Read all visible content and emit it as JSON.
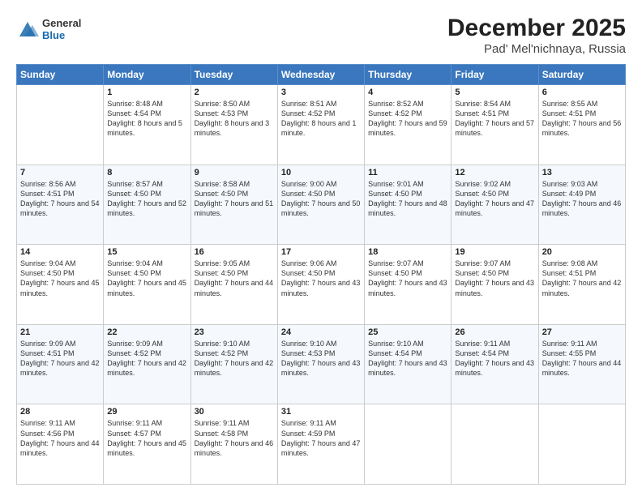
{
  "logo": {
    "general": "General",
    "blue": "Blue"
  },
  "title": "December 2025",
  "subtitle": "Pad' Mel'nichnaya, Russia",
  "days_of_week": [
    "Sunday",
    "Monday",
    "Tuesday",
    "Wednesday",
    "Thursday",
    "Friday",
    "Saturday"
  ],
  "weeks": [
    [
      {
        "day": "",
        "content": ""
      },
      {
        "day": "1",
        "content": "Sunrise: 8:48 AM\nSunset: 4:54 PM\nDaylight: 8 hours\nand 5 minutes."
      },
      {
        "day": "2",
        "content": "Sunrise: 8:50 AM\nSunset: 4:53 PM\nDaylight: 8 hours\nand 3 minutes."
      },
      {
        "day": "3",
        "content": "Sunrise: 8:51 AM\nSunset: 4:52 PM\nDaylight: 8 hours\nand 1 minute."
      },
      {
        "day": "4",
        "content": "Sunrise: 8:52 AM\nSunset: 4:52 PM\nDaylight: 7 hours\nand 59 minutes."
      },
      {
        "day": "5",
        "content": "Sunrise: 8:54 AM\nSunset: 4:51 PM\nDaylight: 7 hours\nand 57 minutes."
      },
      {
        "day": "6",
        "content": "Sunrise: 8:55 AM\nSunset: 4:51 PM\nDaylight: 7 hours\nand 56 minutes."
      }
    ],
    [
      {
        "day": "7",
        "content": "Sunrise: 8:56 AM\nSunset: 4:51 PM\nDaylight: 7 hours\nand 54 minutes."
      },
      {
        "day": "8",
        "content": "Sunrise: 8:57 AM\nSunset: 4:50 PM\nDaylight: 7 hours\nand 52 minutes."
      },
      {
        "day": "9",
        "content": "Sunrise: 8:58 AM\nSunset: 4:50 PM\nDaylight: 7 hours\nand 51 minutes."
      },
      {
        "day": "10",
        "content": "Sunrise: 9:00 AM\nSunset: 4:50 PM\nDaylight: 7 hours\nand 50 minutes."
      },
      {
        "day": "11",
        "content": "Sunrise: 9:01 AM\nSunset: 4:50 PM\nDaylight: 7 hours\nand 48 minutes."
      },
      {
        "day": "12",
        "content": "Sunrise: 9:02 AM\nSunset: 4:50 PM\nDaylight: 7 hours\nand 47 minutes."
      },
      {
        "day": "13",
        "content": "Sunrise: 9:03 AM\nSunset: 4:49 PM\nDaylight: 7 hours\nand 46 minutes."
      }
    ],
    [
      {
        "day": "14",
        "content": "Sunrise: 9:04 AM\nSunset: 4:50 PM\nDaylight: 7 hours\nand 45 minutes."
      },
      {
        "day": "15",
        "content": "Sunrise: 9:04 AM\nSunset: 4:50 PM\nDaylight: 7 hours\nand 45 minutes."
      },
      {
        "day": "16",
        "content": "Sunrise: 9:05 AM\nSunset: 4:50 PM\nDaylight: 7 hours\nand 44 minutes."
      },
      {
        "day": "17",
        "content": "Sunrise: 9:06 AM\nSunset: 4:50 PM\nDaylight: 7 hours\nand 43 minutes."
      },
      {
        "day": "18",
        "content": "Sunrise: 9:07 AM\nSunset: 4:50 PM\nDaylight: 7 hours\nand 43 minutes."
      },
      {
        "day": "19",
        "content": "Sunrise: 9:07 AM\nSunset: 4:50 PM\nDaylight: 7 hours\nand 43 minutes."
      },
      {
        "day": "20",
        "content": "Sunrise: 9:08 AM\nSunset: 4:51 PM\nDaylight: 7 hours\nand 42 minutes."
      }
    ],
    [
      {
        "day": "21",
        "content": "Sunrise: 9:09 AM\nSunset: 4:51 PM\nDaylight: 7 hours\nand 42 minutes."
      },
      {
        "day": "22",
        "content": "Sunrise: 9:09 AM\nSunset: 4:52 PM\nDaylight: 7 hours\nand 42 minutes."
      },
      {
        "day": "23",
        "content": "Sunrise: 9:10 AM\nSunset: 4:52 PM\nDaylight: 7 hours\nand 42 minutes."
      },
      {
        "day": "24",
        "content": "Sunrise: 9:10 AM\nSunset: 4:53 PM\nDaylight: 7 hours\nand 43 minutes."
      },
      {
        "day": "25",
        "content": "Sunrise: 9:10 AM\nSunset: 4:54 PM\nDaylight: 7 hours\nand 43 minutes."
      },
      {
        "day": "26",
        "content": "Sunrise: 9:11 AM\nSunset: 4:54 PM\nDaylight: 7 hours\nand 43 minutes."
      },
      {
        "day": "27",
        "content": "Sunrise: 9:11 AM\nSunset: 4:55 PM\nDaylight: 7 hours\nand 44 minutes."
      }
    ],
    [
      {
        "day": "28",
        "content": "Sunrise: 9:11 AM\nSunset: 4:56 PM\nDaylight: 7 hours\nand 44 minutes."
      },
      {
        "day": "29",
        "content": "Sunrise: 9:11 AM\nSunset: 4:57 PM\nDaylight: 7 hours\nand 45 minutes."
      },
      {
        "day": "30",
        "content": "Sunrise: 9:11 AM\nSunset: 4:58 PM\nDaylight: 7 hours\nand 46 minutes."
      },
      {
        "day": "31",
        "content": "Sunrise: 9:11 AM\nSunset: 4:59 PM\nDaylight: 7 hours\nand 47 minutes."
      },
      {
        "day": "",
        "content": ""
      },
      {
        "day": "",
        "content": ""
      },
      {
        "day": "",
        "content": ""
      }
    ]
  ]
}
